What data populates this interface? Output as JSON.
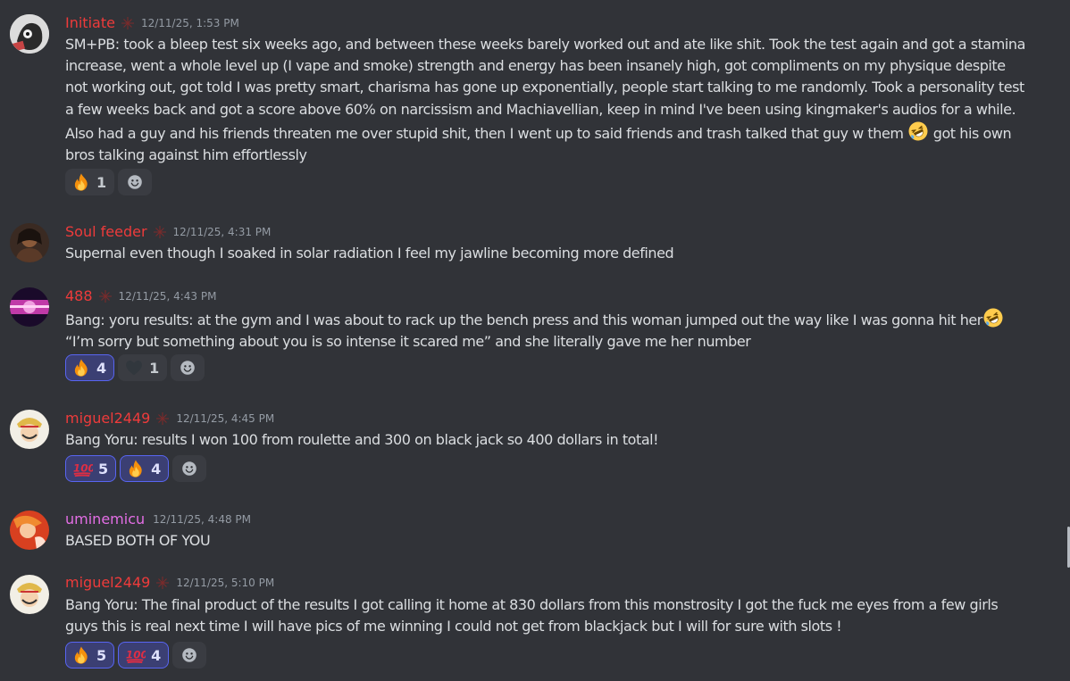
{
  "messages": [
    {
      "username": "Initiate",
      "username_color": "#ee3b3b",
      "timestamp": "12/11/25, 1:53 PM",
      "lines": [
        "SM+PB: took a bleep test six weeks ago, and between these weeks barely worked out and ate like shit. Took the test again and got a stamina increase, went a whole level up (I vape and smoke) strength and energy has been insanely high, got compliments on my physique despite not working out, got told I was pretty smart, charisma has gone up exponentially, people start talking to me randomly. Took a personality test a few weeks back and got a score above 60% on narcissism and Machiavellian, keep in mind I've been using kingmaker's audios for a while."
      ],
      "line2_before": "Also had a guy and his friends threaten me over stupid shit, then I went up to said friends and trash talked that guy w them ",
      "line2_after": " got his own bros talking against him effortlessly",
      "reactions": [
        {
          "emoji": "fire",
          "count": "1",
          "mine": false
        }
      ]
    },
    {
      "username": "Soul feeder",
      "username_color": "#ee3b3b",
      "timestamp": "12/11/25, 4:31 PM",
      "text": "Supernal even though I soaked in solar radiation I feel my jawline becoming more defined"
    },
    {
      "username": "488",
      "username_color": "#ee3b3b",
      "timestamp": "12/11/25, 4:43 PM",
      "text_before": "Bang: yoru results: at the gym and I was about to rack up the bench press and this woman jumped out the way like I was gonna hit her",
      "text_after": " “I’m sorry but something about you is so intense it scared me” and she literally gave me her number",
      "reactions": [
        {
          "emoji": "fire",
          "count": "4",
          "mine": true
        },
        {
          "emoji": "black-heart",
          "count": "1",
          "mine": false
        }
      ]
    },
    {
      "username": "miguel2449",
      "username_color": "#ee3b3b",
      "timestamp": "12/11/25, 4:45 PM",
      "text": "Bang Yoru: results I won 100 from roulette and 300 on black jack so 400 dollars in total!",
      "reactions": [
        {
          "emoji": "100",
          "count": "5",
          "mine": true
        },
        {
          "emoji": "fire",
          "count": "4",
          "mine": true
        }
      ]
    },
    {
      "username": "uminemicu",
      "username_color": "#e36ee5",
      "timestamp": "12/11/25, 4:48 PM",
      "text": "BASED BOTH OF YOU"
    },
    {
      "username": "miguel2449",
      "username_color": "#ee3b3b",
      "timestamp": "12/11/25, 5:10 PM",
      "text": "Bang Yoru: The final product of the results I got calling it home at 830 dollars from this monstrosity I got the fuck me eyes from a few girls guys this is real next time I will have pics of me winning I could not get from blackjack but I will for sure with slots !",
      "reactions": [
        {
          "emoji": "fire",
          "count": "5",
          "mine": true
        },
        {
          "emoji": "100",
          "count": "4",
          "mine": true
        }
      ]
    }
  ],
  "colors": {
    "background": "#313338",
    "timestamp": "#949ba4",
    "text": "#dbdee1",
    "blurple": "#5865f2"
  }
}
